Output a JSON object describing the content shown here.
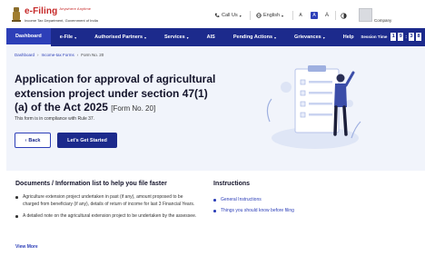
{
  "header": {
    "logo_title": "e-Filing",
    "logo_tagline": "Anywhere Anytime",
    "logo_subtitle": "Income Tax Department, Government of India",
    "call_us": "Call Us",
    "language": "English",
    "font_small": "A",
    "font_normal": "A",
    "font_large": "A",
    "user_label": "Company"
  },
  "nav": {
    "items": [
      {
        "label": "Dashboard",
        "active": true
      },
      {
        "label": "e-File",
        "dropdown": true
      },
      {
        "label": "Authorised Partners",
        "dropdown": true
      },
      {
        "label": "Services",
        "dropdown": true
      },
      {
        "label": "AIS"
      },
      {
        "label": "Pending Actions",
        "dropdown": true
      },
      {
        "label": "Grievances",
        "dropdown": true
      },
      {
        "label": "Help"
      }
    ],
    "session_label": "Session Time",
    "session_digits": [
      "1",
      "9",
      "3",
      "8"
    ]
  },
  "breadcrumb": [
    "Dashboard",
    "Income-tax Forms",
    "Form No. 20"
  ],
  "hero": {
    "title": "Application for approval of agricultural extension project under section 47(1)(a) of the Act 2025",
    "form_no": "[Form No. 20]",
    "note": "This form is in compliance with Rule 37.",
    "back_label": "Back",
    "start_label": "Let's Get Started"
  },
  "documents": {
    "title": "Documents / Information list to help you file faster",
    "items": [
      "Agriculture extension project undertaken in past (if any), amount proposed to be charged from beneficiary (if any), details of return of income for last 3 Financial Years.",
      "A detailed note on the agricultural extension project to be undertaken by the assessee."
    ],
    "view_more": "View More"
  },
  "instructions": {
    "title": "Instructions",
    "items": [
      "General Instructions",
      "Things you should know before filing"
    ]
  },
  "colors": {
    "brand": "#1c2a8c",
    "accent": "#2d3fb8",
    "hero_bg": "#f1f4fb",
    "logo_red": "#c62828"
  }
}
